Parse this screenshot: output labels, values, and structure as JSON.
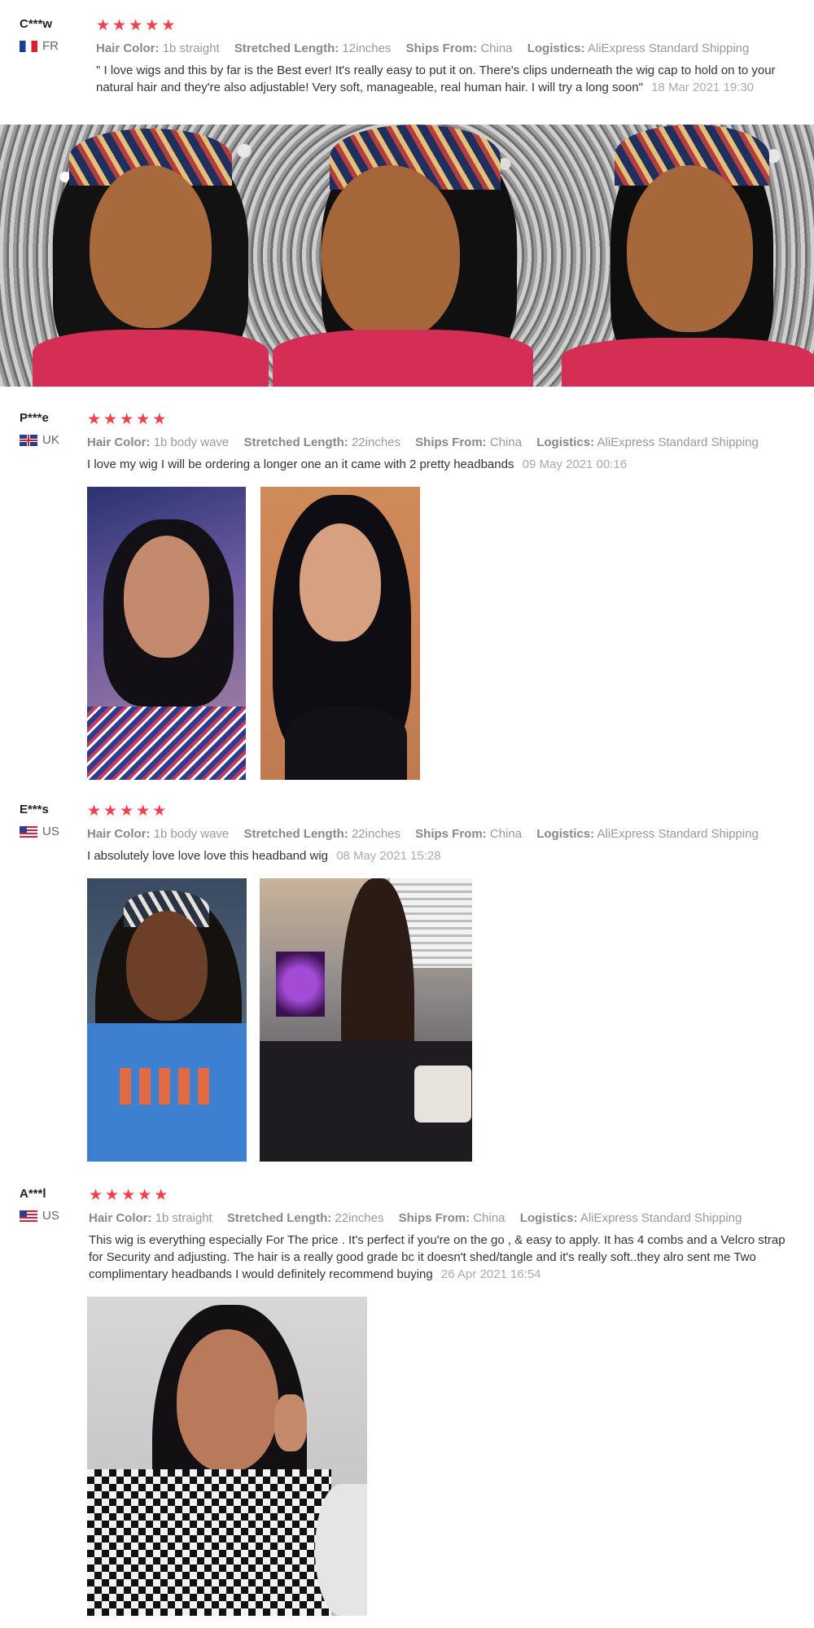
{
  "labels": {
    "hair_color": "Hair Color:",
    "stretched_length": "Stretched Length:",
    "ships_from": "Ships From:",
    "logistics": "Logistics:"
  },
  "star_glyph": "★",
  "star_color": "#f23f4a",
  "reviews": [
    {
      "user": "C***w",
      "country": "FR",
      "rating": 5,
      "hair_color": "1b straight",
      "stretched_length": "12inches",
      "ships_from": "China",
      "logistics": "AliExpress Standard Shipping",
      "text": "\" I love wigs and this by far is the Best ever! It's really easy to put it on. There's clips underneath the wig cap to hold on to your natural hair and they're also adjustable! Very soft, manageable, real human hair. I will try a long soon\"",
      "date": "18 Mar 2021 19:30"
    },
    {
      "user": "P***e",
      "country": "UK",
      "rating": 5,
      "hair_color": "1b body wave",
      "stretched_length": "22inches",
      "ships_from": "China",
      "logistics": "AliExpress Standard Shipping",
      "text": "I love my wig I will be ordering a longer one an it came with 2 pretty headbands",
      "date": "09 May 2021 00:16"
    },
    {
      "user": "E***s",
      "country": "US",
      "rating": 5,
      "hair_color": "1b body wave",
      "stretched_length": "22inches",
      "ships_from": "China",
      "logistics": "AliExpress Standard Shipping",
      "text": "I absolutely love love love this headband wig",
      "date": "08 May 2021 15:28"
    },
    {
      "user": "A***l",
      "country": "US",
      "rating": 5,
      "hair_color": "1b straight",
      "stretched_length": "22inches",
      "ships_from": "China",
      "logistics": "AliExpress Standard Shipping",
      "text": "This wig is everything especially For The price . It's perfect if you're on the go , & easy to apply. It has 4 combs and a Velcro strap for Security and adjusting. The hair is a really good grade bc it doesn't shed/tangle and it's really soft..they alro sent me Two complimentary headbands I would definitely recommend buying",
      "date": "26 Apr 2021 16:54"
    }
  ]
}
